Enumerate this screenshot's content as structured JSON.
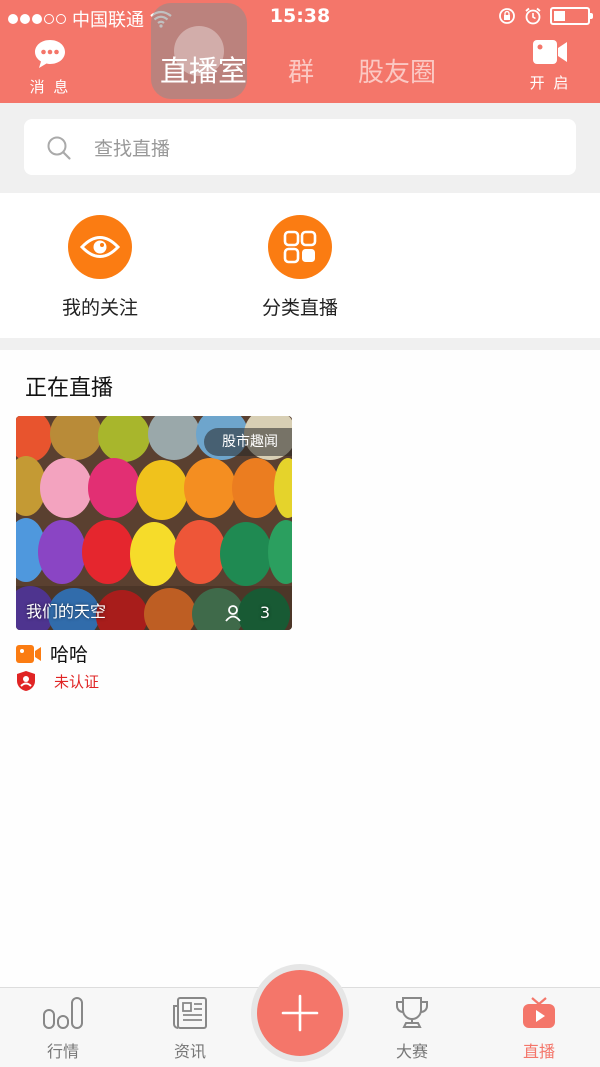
{
  "status_bar": {
    "carrier": "中国联通",
    "time": "15:38"
  },
  "header": {
    "left_button": {
      "label": "消 息",
      "icon": "chat-bubble-icon"
    },
    "right_button": {
      "label": "开 启",
      "icon": "video-camera-icon"
    },
    "tabs": [
      {
        "label": "直播室",
        "active": true
      },
      {
        "label": "群",
        "active": false
      },
      {
        "label": "股友圈",
        "active": false
      }
    ]
  },
  "search": {
    "placeholder": "查找直播",
    "icon": "search-icon"
  },
  "shortcuts": [
    {
      "label": "我的关注",
      "icon": "eye-icon"
    },
    {
      "label": "分类直播",
      "icon": "grid-icon"
    }
  ],
  "live_section": {
    "title": "正在直播",
    "cards": [
      {
        "tag": "股市趣闻",
        "room_name": "我们的天空",
        "viewers": "3",
        "host_name": "哈哈",
        "cert_status": "未认证"
      }
    ]
  },
  "bottom_nav": {
    "items": [
      {
        "label": "行情",
        "icon": "bar-chart-icon",
        "active": false
      },
      {
        "label": "资讯",
        "icon": "newspaper-icon",
        "active": false
      },
      {
        "label": "",
        "icon": "plus-icon",
        "active": false
      },
      {
        "label": "大赛",
        "icon": "trophy-icon",
        "active": false
      },
      {
        "label": "直播",
        "icon": "tv-play-icon",
        "active": true
      }
    ]
  },
  "colors": {
    "header": "#f4766a",
    "accent_orange": "#fb7c12",
    "cert_red": "#e02424",
    "active_nav": "#f4766a"
  }
}
